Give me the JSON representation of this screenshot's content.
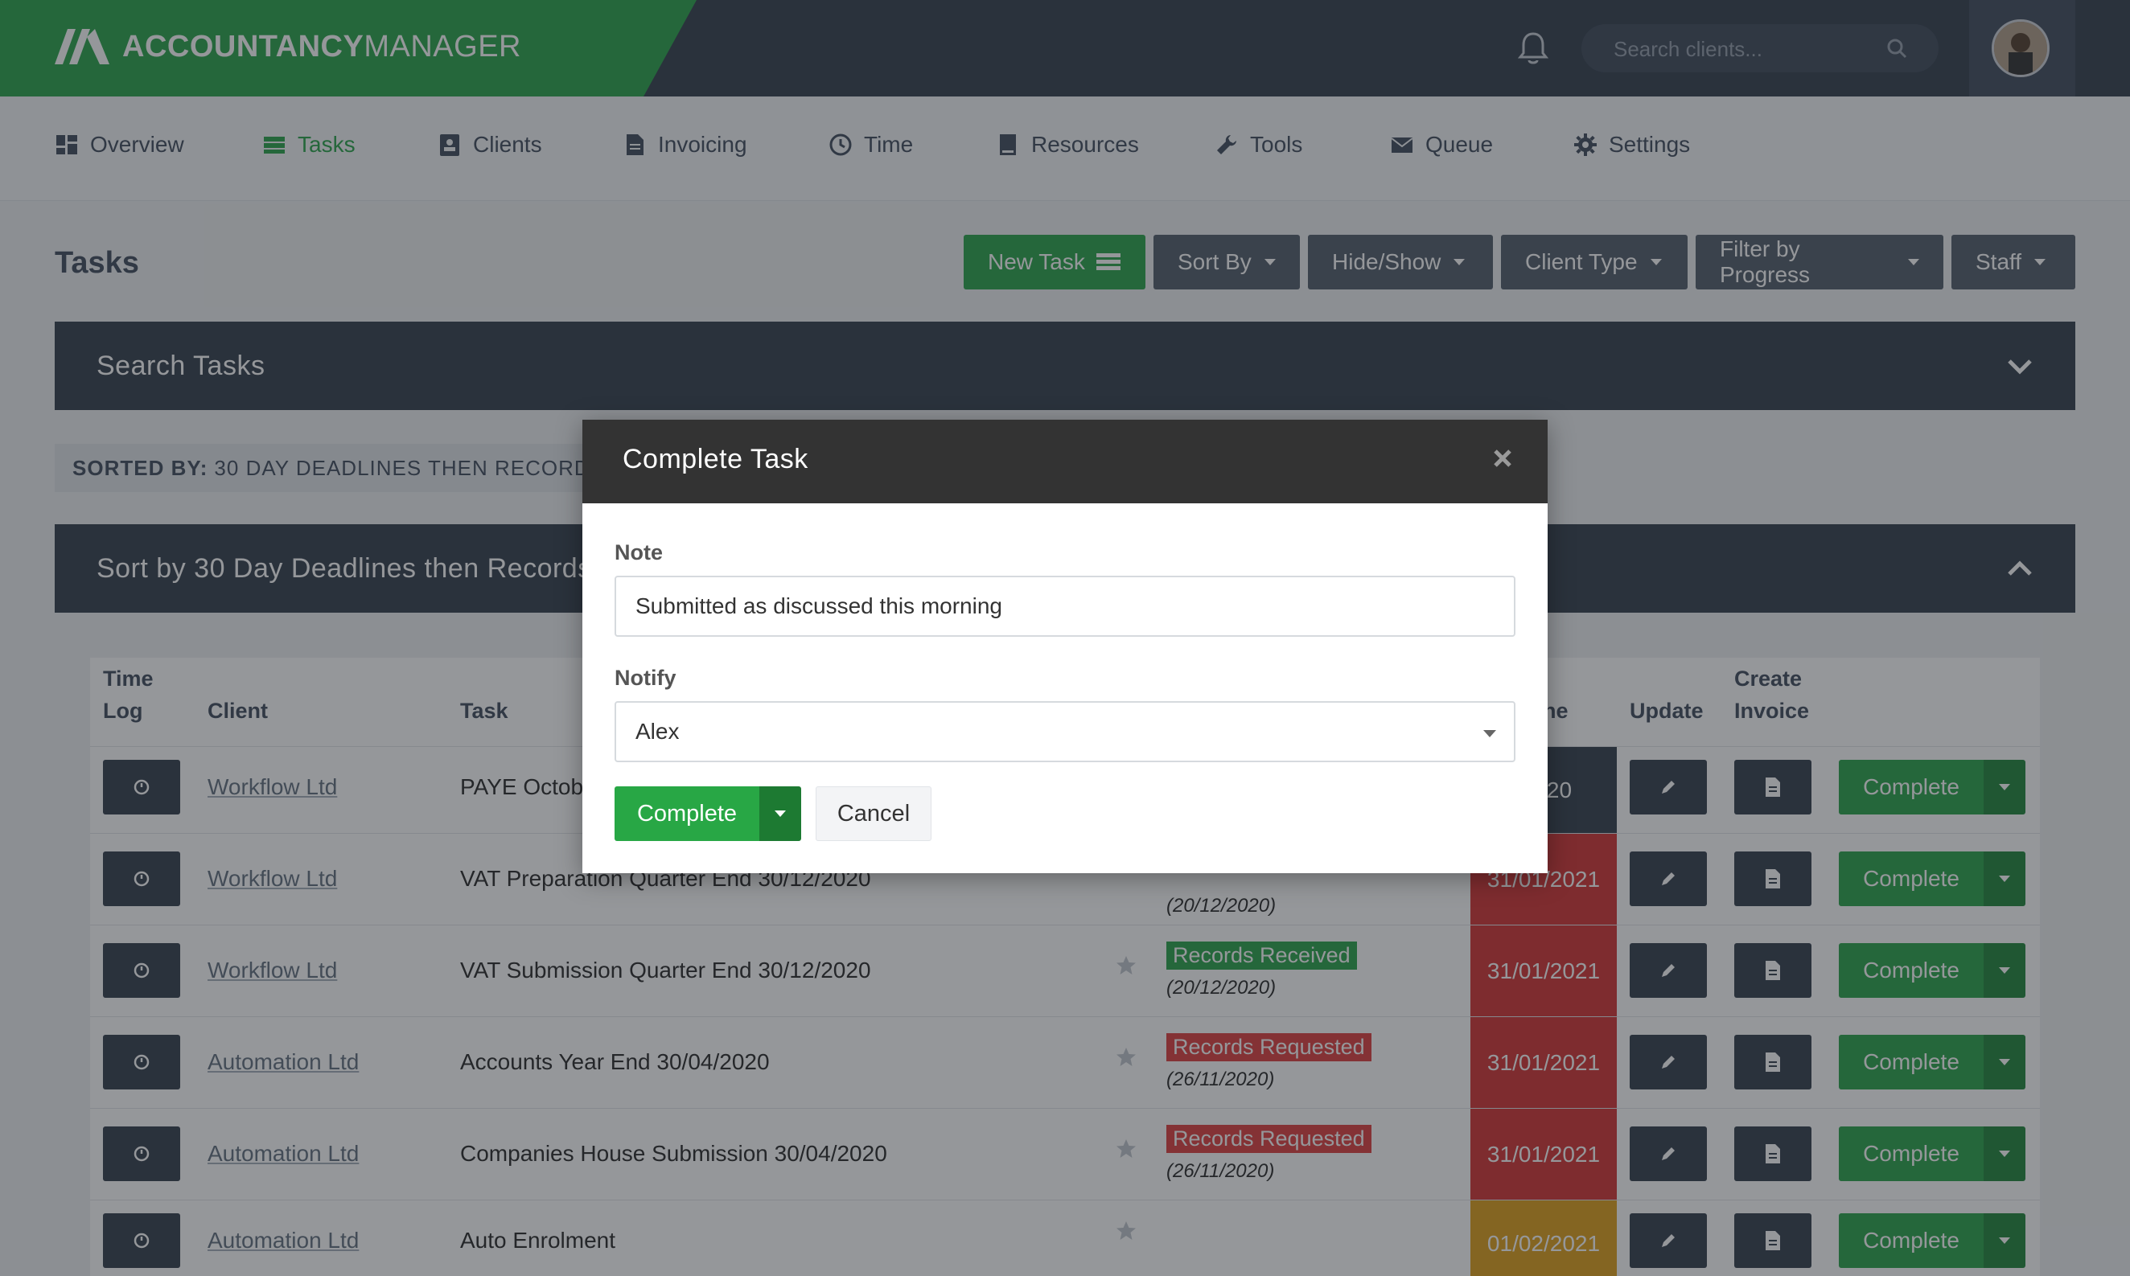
{
  "header": {
    "brand_bold": "ACCOUNTANCY",
    "brand_light": "MANAGER",
    "search_placeholder": "Search clients...",
    "brand_color": "#34a853"
  },
  "nav": {
    "items": [
      {
        "label": "Overview",
        "icon": "dashboard-icon"
      },
      {
        "label": "Tasks",
        "icon": "tasks-icon",
        "active": true
      },
      {
        "label": "Clients",
        "icon": "contact-card-icon"
      },
      {
        "label": "Invoicing",
        "icon": "document-icon"
      },
      {
        "label": "Time",
        "icon": "clock-icon"
      },
      {
        "label": "Resources",
        "icon": "book-icon"
      },
      {
        "label": "Tools",
        "icon": "wrench-icon"
      },
      {
        "label": "Queue",
        "icon": "envelope-icon"
      },
      {
        "label": "Settings",
        "icon": "gear-icon"
      }
    ]
  },
  "page": {
    "title": "Tasks",
    "toolbar": {
      "new_task": "New Task",
      "sort_by": "Sort By",
      "hide_show": "Hide/Show",
      "client_type": "Client Type",
      "filter_progress": "Filter by Progress",
      "staff": "Staff"
    },
    "search_panel": "Search Tasks",
    "sorted_by_label": "SORTED BY:",
    "sorted_by_value": "30 DAY DEADLINES THEN RECORDS",
    "sort_panel": "Sort by 30 Day Deadlines then Records"
  },
  "table": {
    "headers": {
      "time_log_1": "Time",
      "time_log_2": "Log",
      "client": "Client",
      "task": "Task",
      "due": "ne",
      "update": "Update",
      "create_invoice_1": "Create",
      "create_invoice_2": "Invoice"
    },
    "complete_label": "Complete",
    "rows": [
      {
        "client": "Workflow Ltd",
        "task": "PAYE Octobe",
        "status": "",
        "status_date": "",
        "due": "/2020",
        "due_color": "dark"
      },
      {
        "client": "Workflow Ltd",
        "task": "VAT Preparation Quarter End 30/12/2020",
        "status": "",
        "status_date": "(20/12/2020)",
        "due": "31/01/2021",
        "due_color": "red"
      },
      {
        "client": "Workflow Ltd",
        "task": "VAT Submission Quarter End 30/12/2020",
        "status": "Records Received",
        "status_color": "green",
        "status_date": "(20/12/2020)",
        "due": "31/01/2021",
        "due_color": "red"
      },
      {
        "client": "Automation Ltd",
        "task": "Accounts Year End 30/04/2020",
        "status": "Records Requested",
        "status_color": "red",
        "status_date": "(26/11/2020)",
        "due": "31/01/2021",
        "due_color": "red"
      },
      {
        "client": "Automation Ltd",
        "task": "Companies House Submission 30/04/2020",
        "status": "Records Requested",
        "status_color": "red",
        "status_date": "(26/11/2020)",
        "due": "31/01/2021",
        "due_color": "red"
      },
      {
        "client": "Automation Ltd",
        "task": "Auto Enrolment",
        "status": "",
        "status_date": "",
        "due": "01/02/2021",
        "due_color": "amber"
      }
    ]
  },
  "modal": {
    "title": "Complete Task",
    "note_label": "Note",
    "note_value": "Submitted as discussed this morning",
    "notify_label": "Notify",
    "notify_value": "Alex",
    "complete_button": "Complete",
    "cancel_button": "Cancel"
  }
}
